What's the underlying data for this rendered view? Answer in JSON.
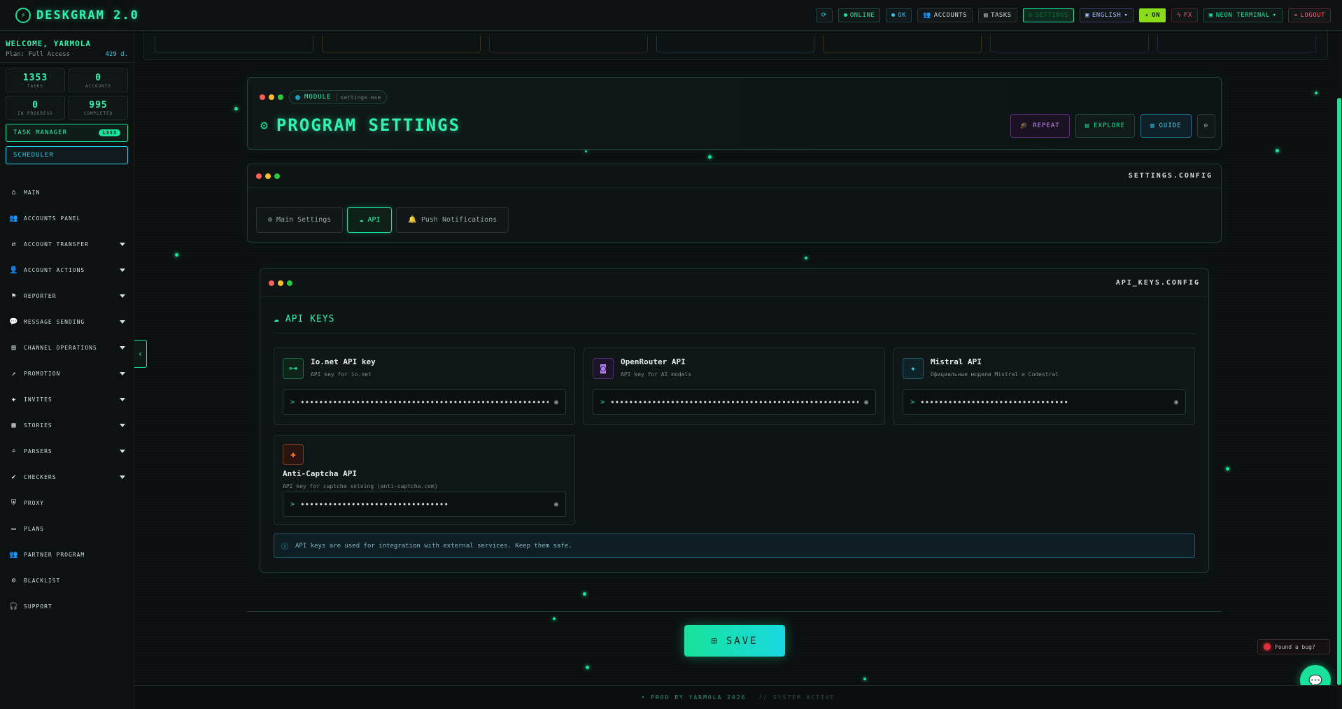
{
  "app": {
    "brand": "DESKGRAM 2.0",
    "brand_logo_glyph": "⚡"
  },
  "topbar": {
    "online": "ONLINE",
    "ok": "OK",
    "accounts": "ACCOUNTS",
    "tasks": "TASKS",
    "settings": "SETTINGS",
    "english": "ENGLISH",
    "on": "ON",
    "fx": "FX",
    "neon_terminal": "NEON TERMINAL",
    "logout": "LOGOUT"
  },
  "sidebar": {
    "welcome": "WELCOME, YARMOLA",
    "plan": "Plan: Full Access",
    "plan_days": "429 d.",
    "stats": [
      {
        "value": "1353",
        "label": "TASKS"
      },
      {
        "value": "0",
        "label": "ACCOUNTS"
      },
      {
        "value": "0",
        "label": "IN PROGRESS"
      },
      {
        "value": "995",
        "label": "COMPLETED"
      }
    ],
    "task_manager": "TASK MANAGER",
    "task_manager_badge": "1353",
    "scheduler": "SCHEDULER",
    "nav": [
      {
        "label": "MAIN",
        "icon": "home-icon",
        "glyph": "⌂",
        "expandable": false
      },
      {
        "label": "ACCOUNTS PANEL",
        "icon": "users-icon",
        "glyph": "👥",
        "expandable": false
      },
      {
        "label": "ACCOUNT TRANSFER",
        "icon": "user-transfer-icon",
        "glyph": "⇄",
        "expandable": true
      },
      {
        "label": "ACCOUNT ACTIONS",
        "icon": "user-actions-icon",
        "glyph": "👤",
        "expandable": true
      },
      {
        "label": "REPORTER",
        "icon": "flag-icon",
        "glyph": "⚑",
        "expandable": true
      },
      {
        "label": "MESSAGE SENDING",
        "icon": "message-icon",
        "glyph": "💬",
        "expandable": true
      },
      {
        "label": "CHANNEL OPERATIONS",
        "icon": "channel-icon",
        "glyph": "▤",
        "expandable": true
      },
      {
        "label": "PROMOTION",
        "icon": "chart-icon",
        "glyph": "↗",
        "expandable": true
      },
      {
        "label": "INVITES",
        "icon": "invite-icon",
        "glyph": "✚",
        "expandable": true
      },
      {
        "label": "STORIES",
        "icon": "stories-icon",
        "glyph": "▦",
        "expandable": true
      },
      {
        "label": "PARSERS",
        "icon": "search-icon",
        "glyph": "⌕",
        "expandable": true
      },
      {
        "label": "CHECKERS",
        "icon": "check-icon",
        "glyph": "✔",
        "expandable": true
      },
      {
        "label": "PROXY",
        "icon": "shield-icon",
        "glyph": "⛨",
        "expandable": false
      },
      {
        "label": "PLANS",
        "icon": "wallet-icon",
        "glyph": "▭",
        "expandable": false
      },
      {
        "label": "PARTNER PROGRAM",
        "icon": "partner-icon",
        "glyph": "👥",
        "expandable": false
      },
      {
        "label": "BLACKLIST",
        "icon": "blacklist-icon",
        "glyph": "⊘",
        "expandable": false
      },
      {
        "label": "SUPPORT",
        "icon": "headset-icon",
        "glyph": "🎧",
        "expandable": false
      }
    ]
  },
  "header": {
    "module_label": "MODULE",
    "module_file": "settings.exe",
    "title": "PROGRAM SETTINGS",
    "repeat": "REPEAT",
    "explore": "EXPLORE",
    "guide": "GUIDE"
  },
  "config": {
    "title": "SETTINGS.CONFIG",
    "tabs": [
      {
        "label": "Main Settings",
        "icon": "gear-icon",
        "glyph": "⚙"
      },
      {
        "label": "API",
        "icon": "cloud-icon",
        "glyph": "☁"
      },
      {
        "label": "Push Notifications",
        "icon": "bell-icon",
        "glyph": "🔔"
      }
    ],
    "active_tab": "API"
  },
  "api": {
    "panel_title": "API_KEYS.CONFIG",
    "section_title": "API KEYS",
    "cards": [
      {
        "title": "Io.net API key",
        "desc": "API key for io.net",
        "icon": "key-icon",
        "glyph": "⊶",
        "value": "••••••••••••••••••••••••••••••••••••••••••••••••••••••••••••••••••••••"
      },
      {
        "title": "OpenRouter API",
        "desc": "API key for AI models",
        "icon": "robot-icon",
        "glyph": "◙",
        "value": "••••••••••••••••••••••••••••••••••••••••••••••••••••••••••••••••••••••••"
      },
      {
        "title": "Mistral API",
        "desc": "Официальные модели Mistral и Codestral",
        "icon": "sparkle-icon",
        "glyph": "✦",
        "value": "••••••••••••••••••••••••••••••••"
      },
      {
        "title": "Anti-Captcha API",
        "desc": "API key for captcha solving (anti-captcha.com)",
        "icon": "puzzle-icon",
        "glyph": "✚",
        "value": "••••••••••••••••••••••••••••••••"
      }
    ],
    "info": "API keys are used for integration with external services. Keep them safe."
  },
  "save": "SAVE",
  "footer": {
    "credit": "• PROD BY YARMOLA 2026",
    "system": "// SYSTEM ACTIVE"
  },
  "bug": "Found a bug?",
  "colors": {
    "accent": "#19e39a",
    "accent_cyan": "#2ad0e8",
    "danger": "#ff5d6f",
    "purple": "#c58cf5"
  }
}
